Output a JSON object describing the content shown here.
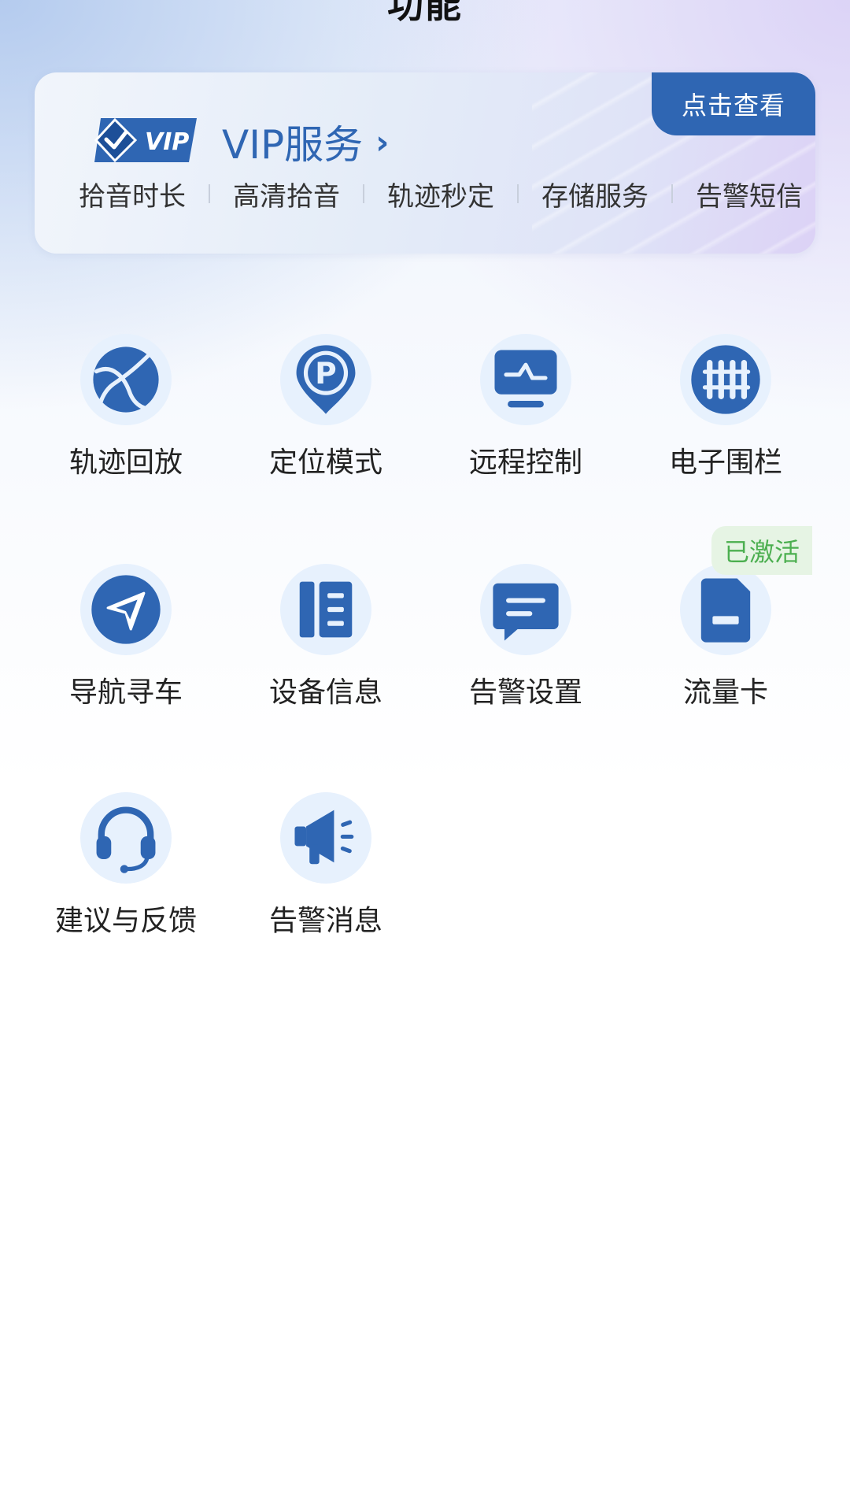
{
  "header": {
    "title": "功能"
  },
  "vip": {
    "logo_text": "VIP",
    "title": "VIP服务",
    "chevron": "›",
    "badge": "点击查看",
    "features": [
      "拾音时长",
      "高清拾音",
      "轨迹秒定",
      "存储服务",
      "告警短信"
    ]
  },
  "grid": {
    "items": [
      {
        "label": "轨迹回放",
        "icon": "globe-route-icon"
      },
      {
        "label": "定位模式",
        "icon": "parking-pin-icon"
      },
      {
        "label": "远程控制",
        "icon": "monitor-pulse-icon"
      },
      {
        "label": "电子围栏",
        "icon": "fence-icon"
      },
      {
        "label": "导航寻车",
        "icon": "navigation-arrow-icon"
      },
      {
        "label": "设备信息",
        "icon": "device-info-icon"
      },
      {
        "label": "告警设置",
        "icon": "message-bubble-icon"
      },
      {
        "label": "流量卡",
        "icon": "sim-card-icon"
      },
      {
        "label": "建议与反馈",
        "icon": "headset-icon"
      },
      {
        "label": "告警消息",
        "icon": "megaphone-icon"
      }
    ],
    "activated_tag": "已激活"
  },
  "colors": {
    "accent": "#2f66b3",
    "icon_bg": "#e7f1fd",
    "activated_text": "#4caf50",
    "activated_bg": "#e6f4e4"
  }
}
